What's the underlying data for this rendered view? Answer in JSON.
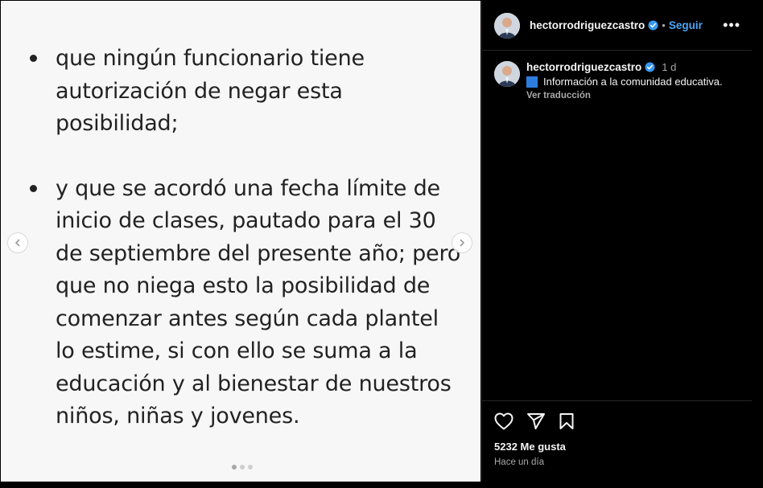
{
  "post": {
    "bullets": [
      "que ningún funcionario tiene autorización de negar esta posibilidad;",
      "y que se acordó una fecha límite de inicio de clases, pautado para el 30 de septiembre del presente año; pero que no niega esto la posibilidad de comenzar antes según cada plantel lo estime, si con ello se suma a la educación y al bienestar de nuestros niños, niñas y jovenes."
    ]
  },
  "header": {
    "username": "hectorrodriguezcastro",
    "separator": "•",
    "follow_label": "Seguir",
    "more_label": "•••"
  },
  "caption": {
    "username": "hectorrodriguezcastro",
    "time": "1 d",
    "text": "Información a la comunidad educativa.",
    "translate_label": "Ver traducción"
  },
  "engagement": {
    "likes_text": "5232 Me gusta",
    "posted_ago": "Hace un día"
  },
  "colors": {
    "accent": "#4aa6f7",
    "verified": "#3897f0",
    "caption_box": "#2d7dde"
  },
  "icons": {
    "prev": "chevron-left-icon",
    "next": "chevron-right-icon",
    "like": "heart-icon",
    "share": "send-icon",
    "save": "bookmark-icon"
  }
}
